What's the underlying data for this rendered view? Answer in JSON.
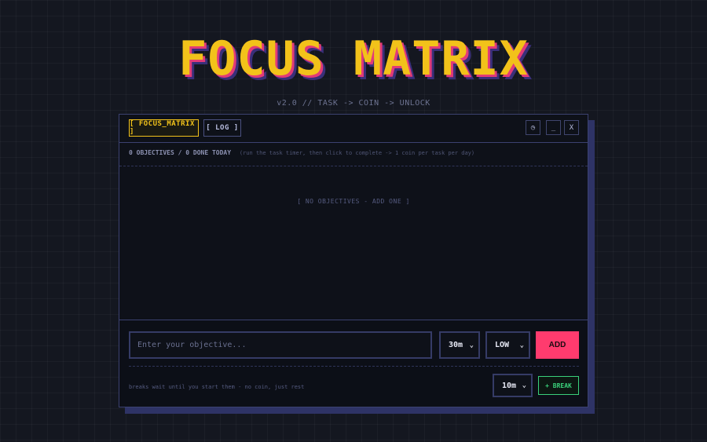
{
  "app": {
    "title": "FOCUS MATRIX",
    "subtitle": "v2.0 // TASK -> COIN -> UNLOCK"
  },
  "tabs": [
    {
      "label": "[ FOCUS_MATRIX ]",
      "active": true
    },
    {
      "label": "[ LOG ]",
      "active": false
    }
  ],
  "window_controls": {
    "history_icon": "clock-icon",
    "history_glyph": "◷",
    "minimize": "_",
    "close": "X"
  },
  "status": {
    "count": "0 OBJECTIVES / 0 DONE TODAY",
    "hint": "(run the task timer, then click to complete -> 1 coin per task per day)"
  },
  "empty_state": "[ NO OBJECTIVES - ADD ONE ]",
  "composer": {
    "placeholder": "Enter your objective...",
    "duration": "30m",
    "priority": "LOW",
    "add_label": "ADD"
  },
  "break": {
    "hint": "breaks wait until you start them - no coin, just rest",
    "duration": "10m",
    "button_label": "+ BREAK"
  },
  "colors": {
    "accent_yellow": "#f2c21a",
    "accent_pink": "#ff3b6e",
    "accent_green": "#3ad07a",
    "background": "#141720"
  }
}
